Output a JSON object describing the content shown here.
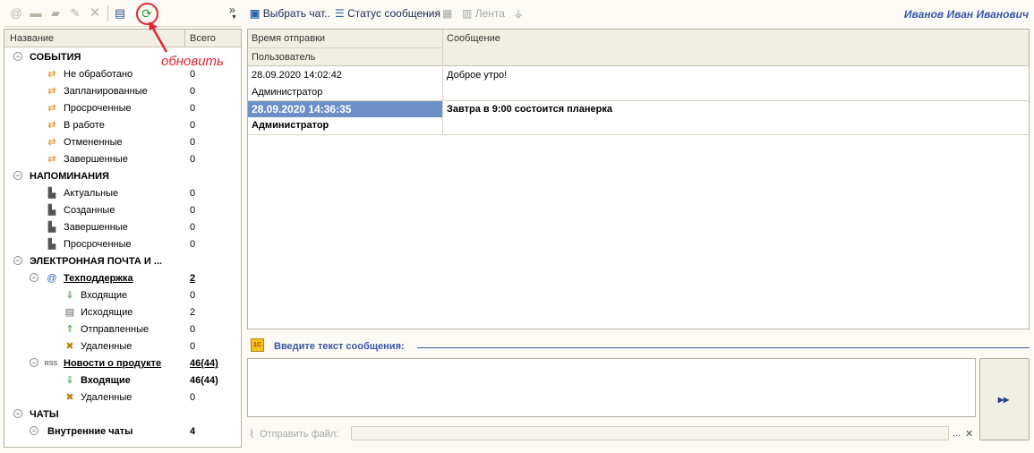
{
  "annotation": {
    "label": "обновить",
    "color": "#e32636"
  },
  "left_toolbar": {
    "icons": [
      "at-icon",
      "folder-add-icon",
      "folder-icon",
      "pencil-icon",
      "delete-icon",
      "export-icon",
      "refresh-icon"
    ],
    "more_label": "»"
  },
  "tree": {
    "headers": {
      "name": "Название",
      "total": "Всего"
    },
    "rows": [
      {
        "label": "СОБЫТИЯ",
        "value": "",
        "level": 0,
        "group": true
      },
      {
        "label": "Не обработано",
        "value": "0",
        "level": 1,
        "icon": "event-icon"
      },
      {
        "label": "Запланированные",
        "value": "0",
        "level": 1,
        "icon": "event-icon"
      },
      {
        "label": "Просроченные",
        "value": "0",
        "level": 1,
        "icon": "event-icon"
      },
      {
        "label": "В работе",
        "value": "0",
        "level": 1,
        "icon": "event-icon"
      },
      {
        "label": "Отмененные",
        "value": "0",
        "level": 1,
        "icon": "event-icon"
      },
      {
        "label": "Завершенные",
        "value": "0",
        "level": 1,
        "icon": "event-icon"
      },
      {
        "label": "НАПОМИНАНИЯ",
        "value": "",
        "level": 0,
        "group": true
      },
      {
        "label": "Актуальные",
        "value": "0",
        "level": 1,
        "icon": "megaphone-icon"
      },
      {
        "label": "Созданные",
        "value": "0",
        "level": 1,
        "icon": "megaphone-icon"
      },
      {
        "label": "Завершенные",
        "value": "0",
        "level": 1,
        "icon": "megaphone-icon"
      },
      {
        "label": "Просроченные",
        "value": "0",
        "level": 1,
        "icon": "megaphone-icon"
      },
      {
        "label": "ЭЛЕКТРОННАЯ ПОЧТА И ...",
        "value": "",
        "level": 0,
        "group": true
      },
      {
        "label": "Техподдержка",
        "value": "2",
        "level": 1,
        "icon": "mail-account-icon",
        "bold": true,
        "underline": true,
        "expander": true
      },
      {
        "label": "Входящие",
        "value": "0",
        "level": 2,
        "icon": "inbox-icon"
      },
      {
        "label": "Исходящие",
        "value": "2",
        "level": 2,
        "icon": "outbox-icon"
      },
      {
        "label": "Отправленные",
        "value": "0",
        "level": 2,
        "icon": "sent-icon"
      },
      {
        "label": "Удаленные",
        "value": "0",
        "level": 2,
        "icon": "trash-icon"
      },
      {
        "label": "Новости о продукте",
        "value": "46(44)",
        "level": 1,
        "icon": "rss-icon",
        "icon_text": "RSS",
        "bold": true,
        "underline": true,
        "expander": true
      },
      {
        "label": "Входящие",
        "value": "46(44)",
        "level": 2,
        "icon": "inbox-icon",
        "bold": true
      },
      {
        "label": "Удаленные",
        "value": "0",
        "level": 2,
        "icon": "trash-icon"
      },
      {
        "label": "ЧАТЫ",
        "value": "",
        "level": 0,
        "group": true
      },
      {
        "label": "Внутренние чаты",
        "value": "4",
        "level": 1,
        "bold": true,
        "expander": true
      }
    ]
  },
  "right_toolbar": {
    "select_chat": "Выбрать чат..",
    "message_status": "Статус сообщения",
    "feed": "Лента",
    "user_name": "Иванов Иван Иванович"
  },
  "messages": {
    "headers": {
      "sent_time": "Время отправки",
      "user": "Пользователь",
      "message": "Сообщение"
    },
    "rows": [
      {
        "time": "28.09.2020 14:02:42",
        "user": "Администратор",
        "text": "Доброе утро!",
        "selected": false
      },
      {
        "time": "28.09.2020 14:36:35",
        "user": "Администратор",
        "text": "Завтра в 9:00 состоится планерка",
        "selected": true
      }
    ]
  },
  "compose": {
    "badge": "1С",
    "prompt": "Введите текст сообщения:",
    "attach_label": "Отправить файл:",
    "attach_value": "",
    "browse_label": "...",
    "clear_label": "✕"
  },
  "colors": {
    "selection": "#6d8fc7",
    "accent": "#3b57a8"
  }
}
